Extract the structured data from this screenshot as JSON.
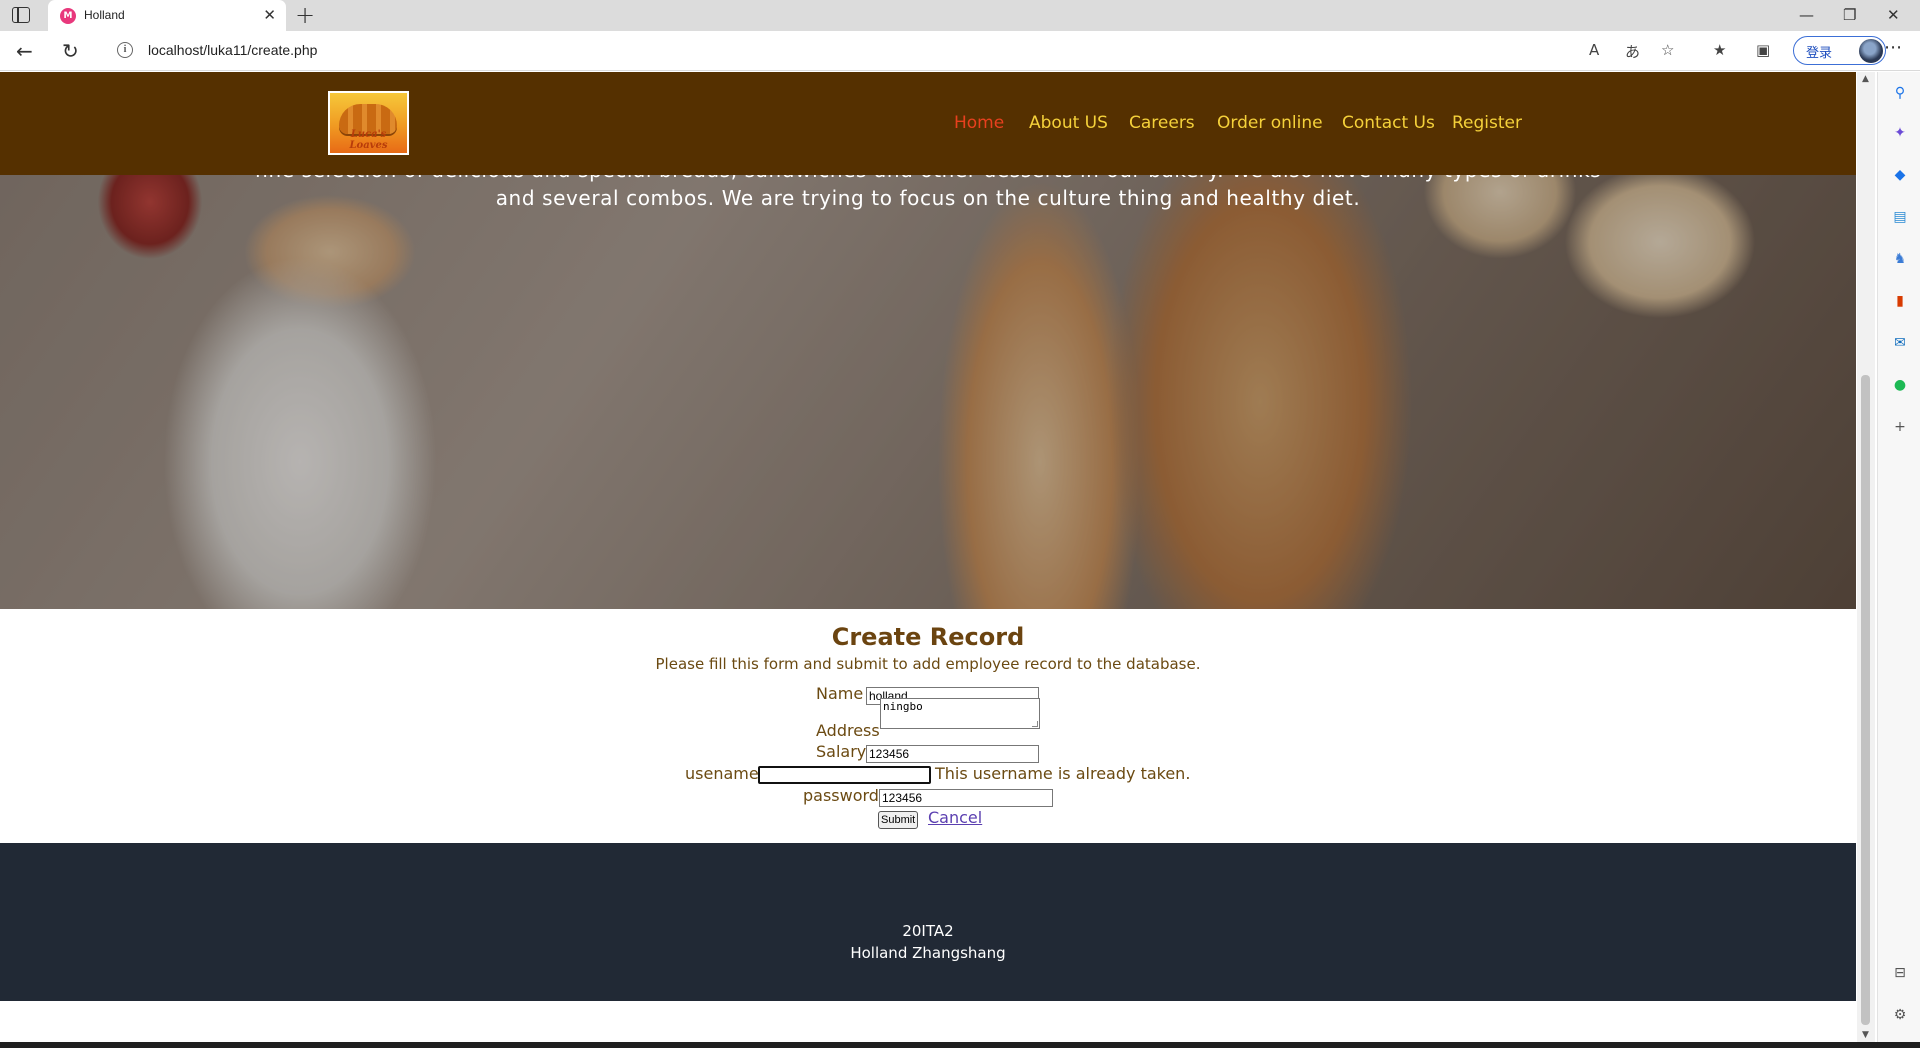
{
  "browser": {
    "tab_title": "Holland",
    "tab_favicon": "M",
    "url": "localhost/luka11/create.php",
    "login_label": "登录",
    "new_tab_symbol": "+"
  },
  "site": {
    "logo_text": "Luca's Loaves",
    "nav": [
      {
        "label": "Home",
        "active": true
      },
      {
        "label": "About US"
      },
      {
        "label": "Careers"
      },
      {
        "label": "Order online"
      },
      {
        "label": "Contact Us"
      },
      {
        "label": "Register"
      }
    ],
    "colors": {
      "navbar": "#553000",
      "nav_link": "#f5d13a",
      "nav_active": "#e8401e",
      "form_text": "#6b4a12",
      "footer": "#212935"
    }
  },
  "hero": {
    "text": "fine selection of delicious and special breads, sandwiches and other desserts in our bakery. We also have many types of drinks and several combos. We are trying to focus on the culture thing and healthy diet."
  },
  "form": {
    "title": "Create Record",
    "description": "Please fill this form and submit to add employee record to the database.",
    "name_label": "Name",
    "name_value": "holland",
    "address_label": "Address",
    "address_value": "ningbo",
    "salary_label": "Salary",
    "salary_value": "123456",
    "username_label": "usename",
    "username_value": "",
    "username_error": "This username is already taken.",
    "password_label": "password",
    "password_value": "123456",
    "submit_label": "Submit",
    "cancel_label": "Cancel"
  },
  "footer": {
    "line1": "20ITA2",
    "line2": "Holland Zhangshang"
  }
}
